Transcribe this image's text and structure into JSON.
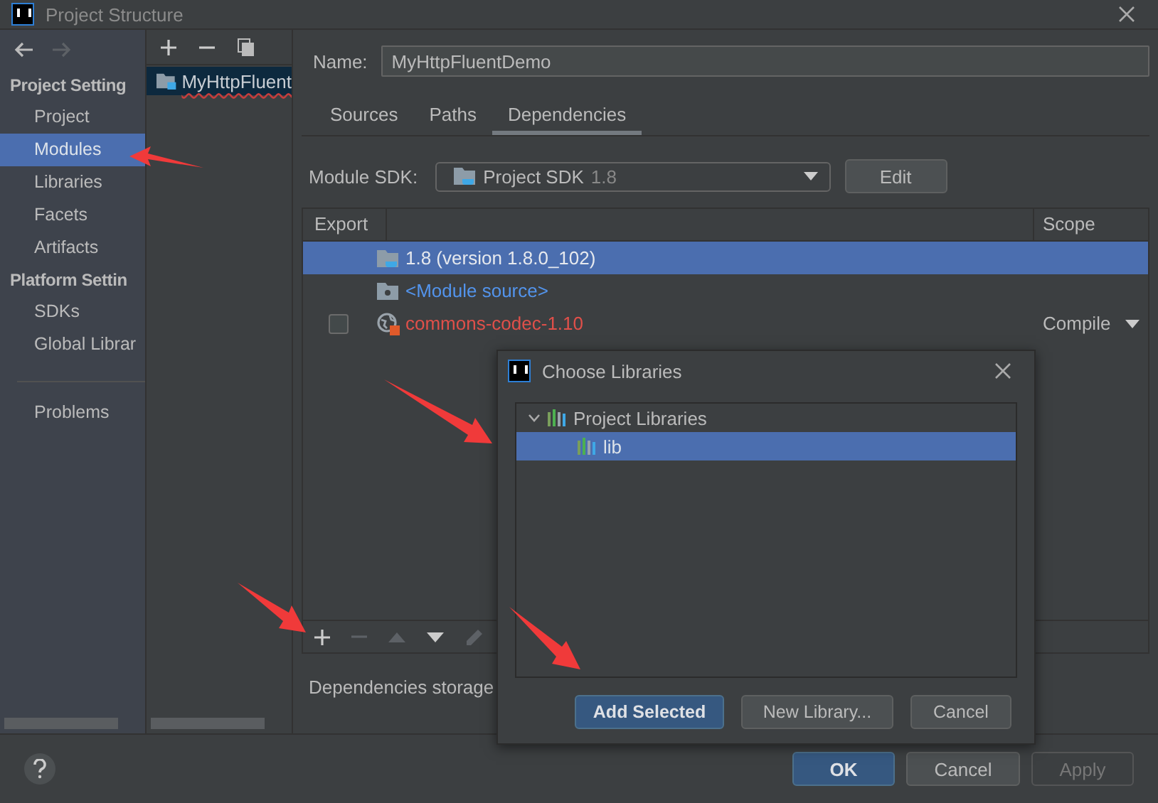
{
  "window": {
    "title": "Project Structure"
  },
  "sidebar": {
    "sections": [
      {
        "heading": "Project Setting",
        "items": [
          {
            "label": "Project",
            "selected": false
          },
          {
            "label": "Modules",
            "selected": true
          },
          {
            "label": "Libraries",
            "selected": false
          },
          {
            "label": "Facets",
            "selected": false
          },
          {
            "label": "Artifacts",
            "selected": false
          }
        ]
      },
      {
        "heading": "Platform Settin",
        "items": [
          {
            "label": "SDKs",
            "selected": false
          },
          {
            "label": "Global Librar",
            "selected": false
          }
        ]
      }
    ],
    "footer_items": [
      {
        "label": "Problems",
        "selected": false
      }
    ]
  },
  "modules": [
    {
      "name": "MyHttpFluent",
      "selected": true
    }
  ],
  "name_field": {
    "label": "Name:",
    "value": "MyHttpFluentDemo"
  },
  "tabs": [
    {
      "label": "Sources",
      "selected": false
    },
    {
      "label": "Paths",
      "selected": false
    },
    {
      "label": "Dependencies",
      "selected": true
    }
  ],
  "module_sdk": {
    "label": "Module SDK:",
    "value": "Project SDK",
    "version": "1.8",
    "edit_button": "Edit"
  },
  "dependencies": {
    "columns": [
      "Export",
      "Scope"
    ],
    "rows": [
      {
        "kind": "sdk",
        "name": "1.8 (version 1.8.0_102)",
        "selected": true
      },
      {
        "kind": "source",
        "name": "<Module source>",
        "selected": false
      },
      {
        "kind": "library",
        "name": "commons-codec-1.10",
        "selected": false,
        "checked": false,
        "error": true,
        "scope": "Compile"
      }
    ]
  },
  "toolbar": [
    {
      "disabled": false
    },
    {
      "disabled": true
    },
    {
      "disabled": true
    },
    {
      "disabled": false
    },
    {
      "disabled": true
    }
  ],
  "storage_label": "Dependencies storage",
  "dialog": {
    "title": "Choose Libraries",
    "tree": [
      {
        "label": "Project Libraries",
        "expanded": true,
        "selected": false,
        "children": [
          {
            "label": "lib",
            "selected": true
          }
        ]
      }
    ],
    "buttons": [
      {
        "label": "Add Selected",
        "kind": "primary"
      },
      {
        "label": "New Library...",
        "kind": "normal"
      },
      {
        "label": "Cancel",
        "kind": "normal"
      }
    ]
  },
  "buttons": [
    {
      "label": "OK",
      "kind": "primary"
    },
    {
      "label": "Cancel",
      "kind": "normal"
    },
    {
      "label": "Apply",
      "kind": "disabled"
    }
  ]
}
